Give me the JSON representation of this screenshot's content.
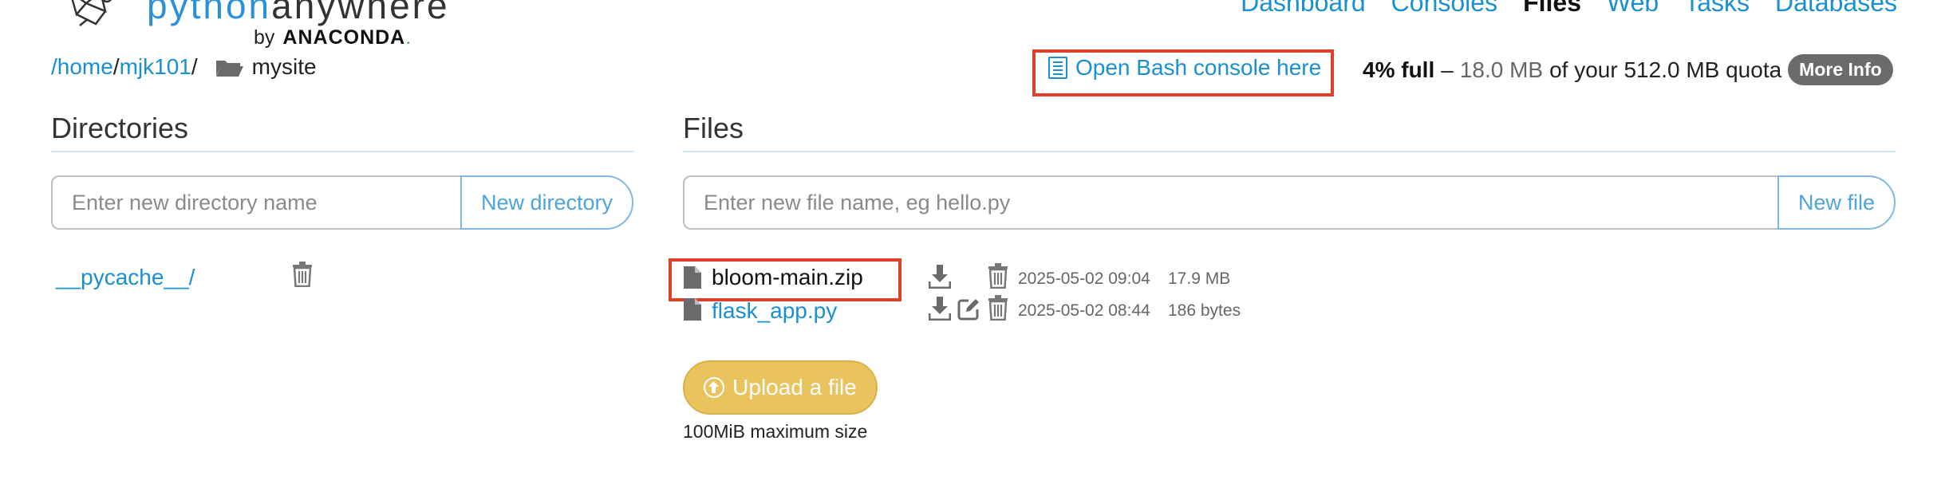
{
  "header": {
    "logo_text_python": "python",
    "logo_text_anywhere": "anywhere",
    "logo_by": "by",
    "logo_brand": "ANACONDA",
    "logo_dot": ".",
    "nav": [
      {
        "label": "Dashboard",
        "active": false
      },
      {
        "label": "Consoles",
        "active": false
      },
      {
        "label": "Files",
        "active": true
      },
      {
        "label": "Web",
        "active": false
      },
      {
        "label": "Tasks",
        "active": false
      },
      {
        "label": "Databases",
        "active": false
      }
    ]
  },
  "path": {
    "home": "/home",
    "sep1": "/",
    "user": "mjk101",
    "sep2": "/",
    "current": "mysite"
  },
  "bash": {
    "label": "Open Bash console here"
  },
  "quota": {
    "percent": "4% full",
    "dash": "–",
    "used": "18.0 MB",
    "rest": "of your 512.0 MB quota",
    "more_info": "More Info"
  },
  "directories": {
    "heading": "Directories",
    "input_placeholder": "Enter new directory name",
    "button_label": "New directory",
    "items": [
      {
        "name": "__pycache__/"
      }
    ]
  },
  "files": {
    "heading": "Files",
    "input_placeholder": "Enter new file name, eg hello.py",
    "button_label": "New file",
    "items": [
      {
        "name": "bloom-main.zip",
        "date": "2025-05-02 09:04",
        "size": "17.9 MB",
        "editable": false
      },
      {
        "name": "flask_app.py",
        "date": "2025-05-02 08:44",
        "size": "186 bytes",
        "editable": true
      }
    ],
    "upload_label": "Upload a file",
    "upload_note": "100MiB maximum size"
  },
  "colors": {
    "link": "#1a8fd1",
    "highlight": "#e0402b",
    "upload": "#e8c35e",
    "badge": "#6b6b6b"
  }
}
